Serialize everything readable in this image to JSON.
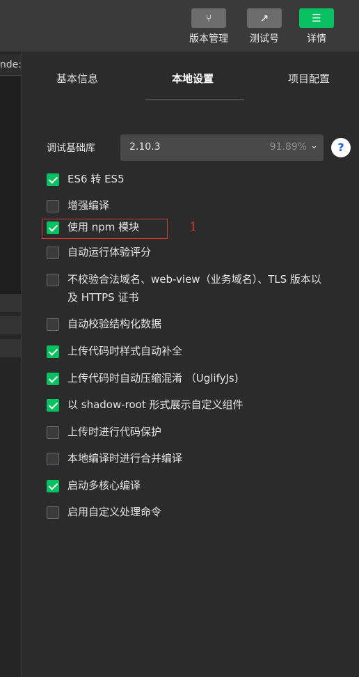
{
  "toolbar": {
    "version_mgmt": "版本管理",
    "test_account": "测试号",
    "details": "详情",
    "version_icon": "branch-icon",
    "test_icon": "share-icon",
    "details_icon": "menu-icon"
  },
  "editor": {
    "tab_label": "inde:"
  },
  "panel": {
    "tabs": [
      "基本信息",
      "本地设置",
      "项目配置"
    ],
    "active_tab": "本地设置",
    "lib": {
      "label": "调试基础库",
      "version": "2.10.3",
      "coverage": "91.89%",
      "help": "?"
    },
    "options": [
      {
        "label": "ES6 转 ES5",
        "checked": true
      },
      {
        "label": "增强编译",
        "checked": false
      },
      {
        "label": "使用 npm 模块",
        "checked": true
      },
      {
        "label": "自动运行体验评分",
        "checked": false
      },
      {
        "label": "不校验合法域名、web-view（业务域名）、TLS 版本以及 HTTPS 证书",
        "checked": false
      },
      {
        "label": "自动校验结构化数据",
        "checked": false
      },
      {
        "label": "上传代码时样式自动补全",
        "checked": true
      },
      {
        "label": "上传代码时自动压缩混淆 （UglifyJs)",
        "checked": true
      },
      {
        "label": "以 shadow-root 形式展示自定义组件",
        "checked": true
      },
      {
        "label": "上传时进行代码保护",
        "checked": false
      },
      {
        "label": "本地编译时进行合并编译",
        "checked": false
      },
      {
        "label": "启动多核心编译",
        "checked": true
      },
      {
        "label": "启用自定义处理命令",
        "checked": false
      }
    ],
    "annotation": "1"
  },
  "colors": {
    "accent": "#07c160",
    "annotation": "#d23a32",
    "help": "#1a5fd6"
  }
}
